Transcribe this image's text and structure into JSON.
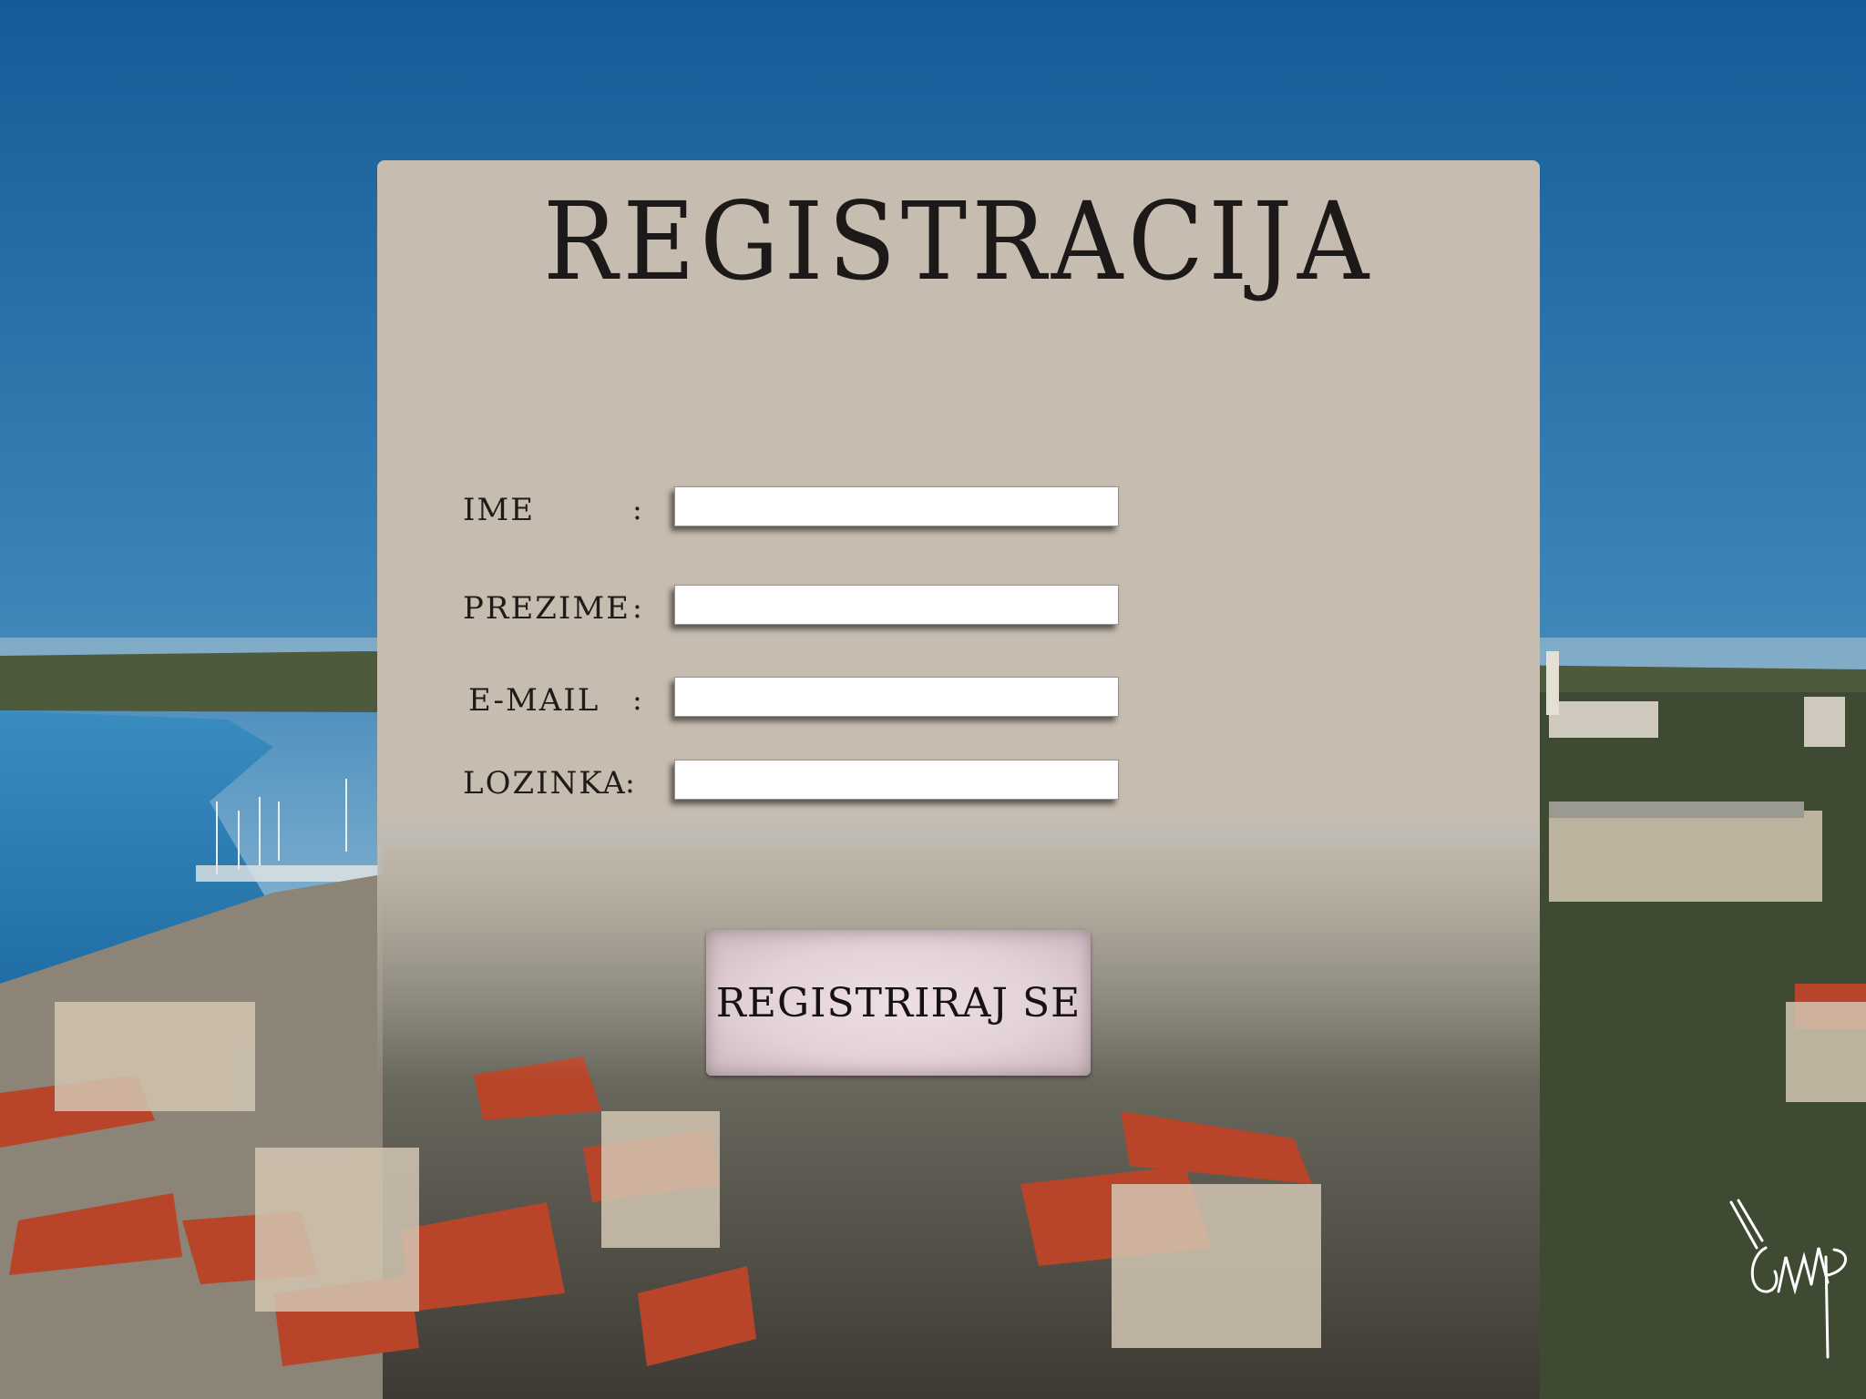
{
  "form": {
    "title": "REGISTRACIJA",
    "fields": [
      {
        "label": "IME",
        "colon": ":",
        "value": ""
      },
      {
        "label": "PREZIME",
        "colon": ":",
        "value": ""
      },
      {
        "label": "E-MAIL",
        "colon": ":",
        "value": ""
      },
      {
        "label": "LOZINKA",
        "colon": ":",
        "value": ""
      }
    ],
    "submit_label": "REGISTRIRAJ SE"
  },
  "colors": {
    "panel": "#c6bdb0",
    "sky": "#2f6d9f",
    "sea": "#2d7fb6",
    "roof": "#b8452a",
    "button": "#e2d1d6"
  }
}
